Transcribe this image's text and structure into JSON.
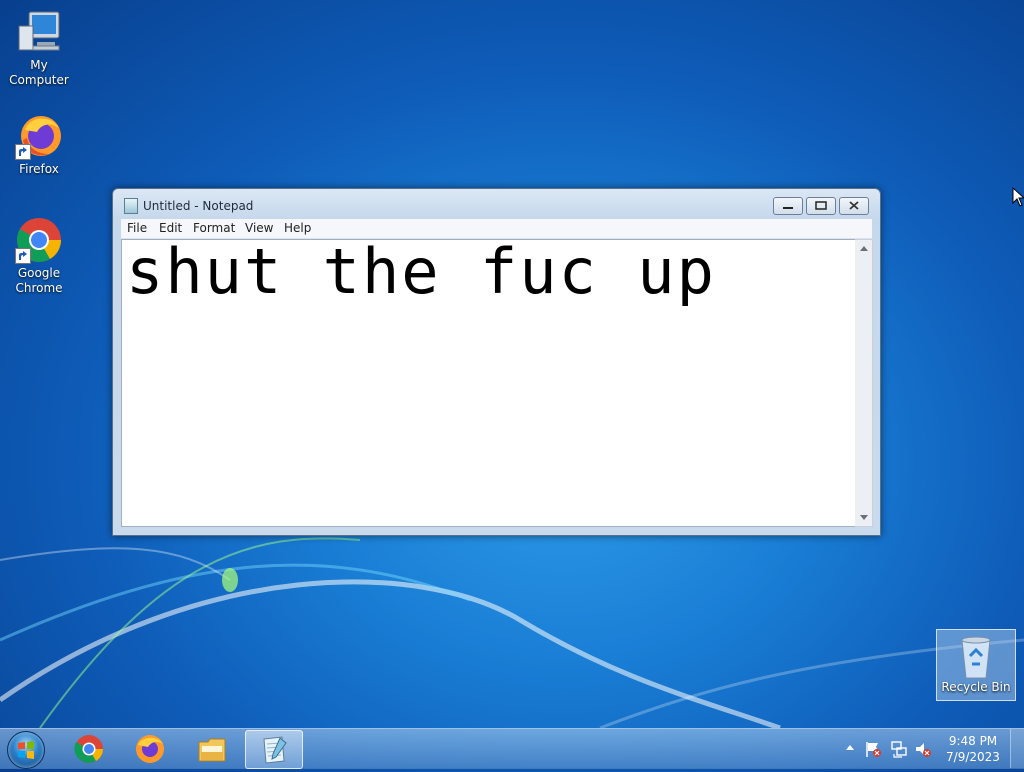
{
  "desktop": {
    "icons": [
      {
        "label": "My Computer",
        "icon": "computer-icon"
      },
      {
        "label": "Firefox",
        "icon": "firefox-icon"
      },
      {
        "label": "Google Chrome",
        "icon": "chrome-icon"
      },
      {
        "label": "Recycle Bin",
        "icon": "recycle-bin-icon"
      }
    ]
  },
  "notepad": {
    "title": "Untitled - Notepad",
    "menu": [
      "File",
      "Edit",
      "Format",
      "View",
      "Help"
    ],
    "content": "shut the fuc up"
  },
  "taskbar": {
    "pinned": [
      "start-orb-icon",
      "chrome-icon",
      "firefox-icon",
      "explorer-icon",
      "notepad-icon"
    ],
    "active_app": "Notepad",
    "tray_icons": [
      "show-hidden-icons-arrow",
      "action-center-flag-icon",
      "network-icon",
      "volume-muted-icon"
    ],
    "time": "9:48 PM",
    "date": "7/9/2023"
  },
  "colors": {
    "desktop_blue": "#0e5cb8",
    "window_frame": "#c6d8ec",
    "close_red": "#c9463d"
  }
}
